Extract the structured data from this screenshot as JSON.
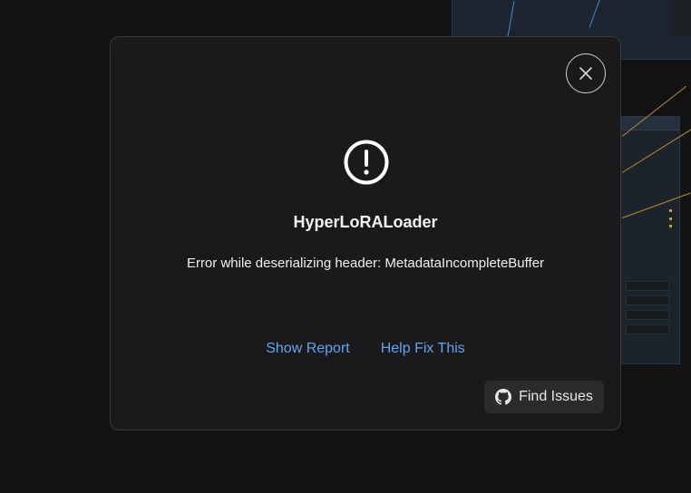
{
  "dialog": {
    "title": "HyperLoRALoader",
    "message": "Error while deserializing header: MetadataIncompleteBuffer",
    "close_icon": "close-icon",
    "alert_icon": "alert-circle-icon",
    "links": {
      "show_report": "Show Report",
      "help_fix": "Help Fix This"
    },
    "find_issues": {
      "label": "Find Issues",
      "icon": "github-icon"
    }
  },
  "colors": {
    "link": "#5ea6f0",
    "modal_bg": "#1a1a1c",
    "button_bg": "#2b2b2e"
  }
}
